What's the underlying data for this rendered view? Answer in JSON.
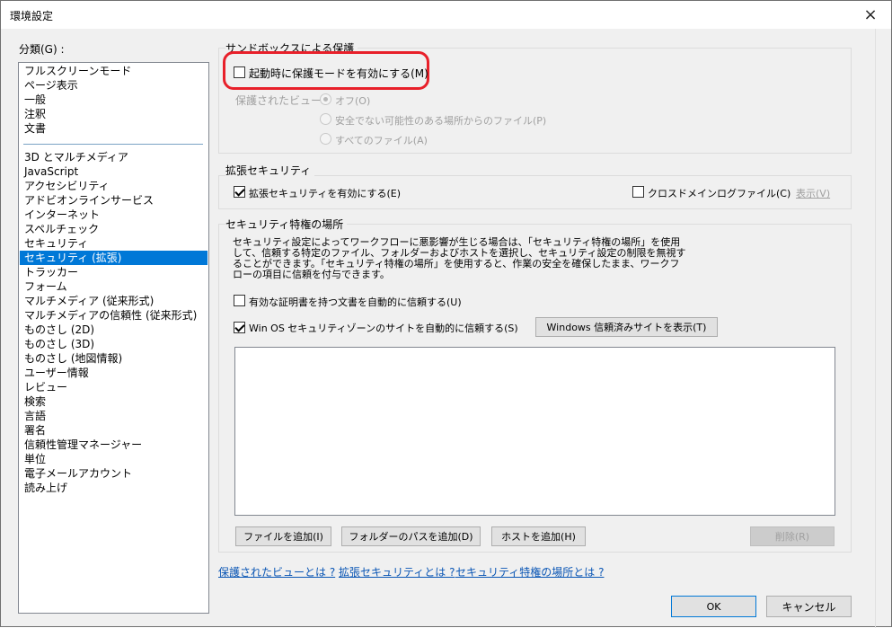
{
  "window": {
    "title": "環境設定",
    "close_icon": "×"
  },
  "categories": {
    "label": "分類(G) :",
    "group1": [
      "フルスクリーンモード",
      "ページ表示",
      "一般",
      "注釈",
      "文書"
    ],
    "group2": [
      "3D とマルチメディア",
      "JavaScript",
      "アクセシビリティ",
      "アドビオンラインサービス",
      "インターネット",
      "スペルチェック",
      "セキュリティ",
      "セキュリティ (拡張)",
      "トラッカー",
      "フォーム",
      "マルチメディア (従来形式)",
      "マルチメディアの信頼性 (従来形式)",
      "ものさし (2D)",
      "ものさし (3D)",
      "ものさし (地図情報)",
      "ユーザー情報",
      "レビュー",
      "検索",
      "言語",
      "署名",
      "信頼性管理マネージャー",
      "単位",
      "電子メールアカウント",
      "読み上げ"
    ],
    "selected": "セキュリティ (拡張)"
  },
  "sandbox": {
    "title": "サンドボックスによる保護",
    "enable_label": "起動時に保護モードを有効にする(M)",
    "enable_checked": false,
    "protected_view_label": "保護されたビュー :",
    "options": [
      "オフ(O)",
      "安全でない可能性のある場所からのファイル(P)",
      "すべてのファイル(A)"
    ],
    "selected_option": "オフ(O)"
  },
  "enhanced": {
    "title": "拡張セキュリティ",
    "enable_label": "拡張セキュリティを有効にする(E)",
    "enable_checked": true,
    "crossdomain_label": "クロスドメインログファイル(C)",
    "crossdomain_checked": false,
    "view_link": "表示(V)"
  },
  "privileged": {
    "title": "セキュリティ特権の場所",
    "description": [
      "セキュリティ設定によってワークフローに悪影響が生じる場合は、「セキュリティ特権の場所」を使用",
      "して、信頼する特定のファイル、フォルダーおよびホストを選択し、セキュリティ設定の制限を無視す",
      "ることができます。「セキュリティ特権の場所」を使用すると、作業の安全を確保したまま、ワークフ",
      "ローの項目に信頼を付与できます。"
    ],
    "trust_cert_label": "有効な証明書を持つ文書を自動的に信頼する(U)",
    "trust_cert_checked": false,
    "trust_winos_label": "Win OS セキュリティゾーンのサイトを自動的に信頼する(S)",
    "trust_winos_checked": true,
    "show_sites_button": "Windows 信頼済みサイトを表示(T)",
    "add_file_button": "ファイルを追加(I)",
    "add_folder_button": "フォルダーのパスを追加(D)",
    "add_host_button": "ホストを追加(H)",
    "delete_button": "削除(R)"
  },
  "help_links": [
    "保護されたビューとは ?",
    "拡張セキュリティとは ?",
    "セキュリティ特権の場所とは ?"
  ],
  "footer": {
    "ok": "OK",
    "cancel": "キャンセル"
  },
  "colors": {
    "selection": "#0078d7",
    "highlight_ring": "#e8202a",
    "link": "#0a56b5"
  }
}
